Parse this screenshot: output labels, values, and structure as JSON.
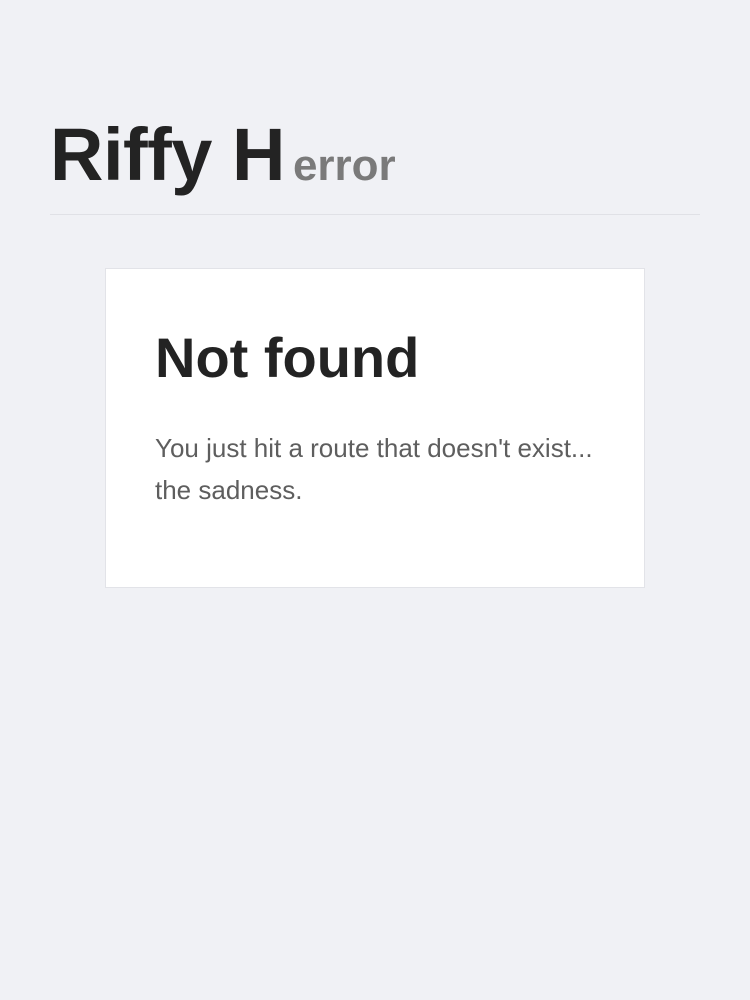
{
  "header": {
    "title": "Riffy H",
    "subtitle": "error"
  },
  "card": {
    "title": "Not found",
    "message": "You just hit a route that doesn't exist... the sadness."
  },
  "colors": {
    "background": "#f0f1f5",
    "card": "#ffffff",
    "title_text": "#232323",
    "subtitle_text": "#7a7a7a",
    "body_text": "#5e5e5e",
    "divider": "#e0e1e6"
  }
}
